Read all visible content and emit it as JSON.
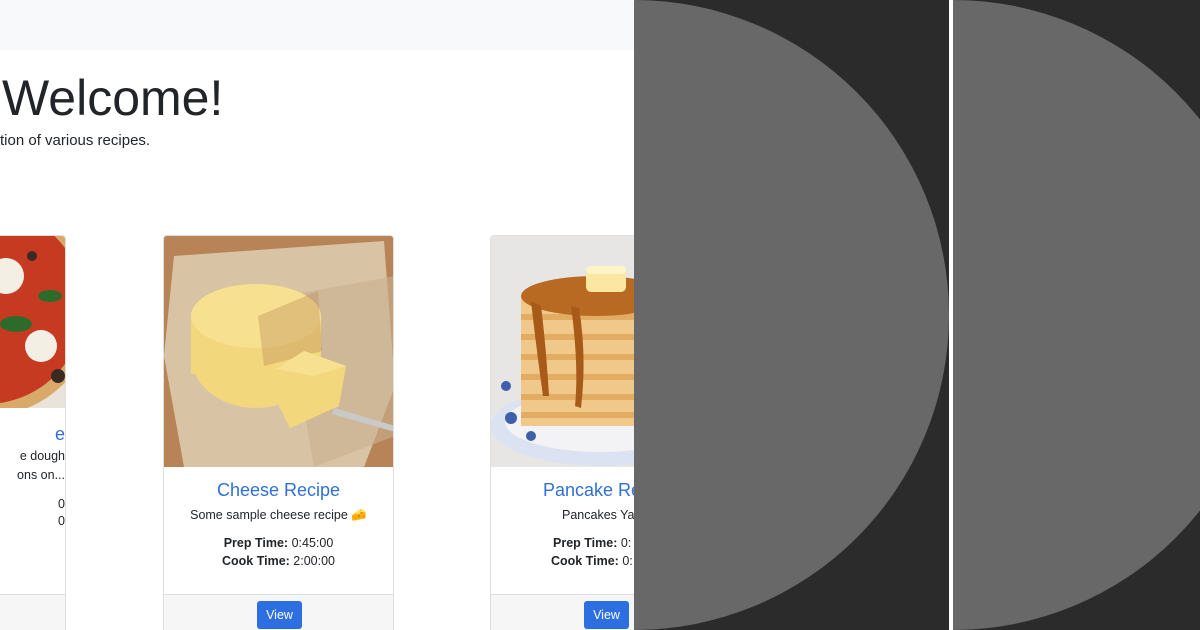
{
  "hero": {
    "title": "Welcome!",
    "subtitle": "tion of various recipes."
  },
  "cards": [
    {
      "title": "e",
      "text_line1": "e dough",
      "text_line2": "ons on...",
      "prep": "0",
      "cook": "0",
      "image": "pizza"
    },
    {
      "title": "Cheese Recipe",
      "text": "Some sample cheese recipe 🧀",
      "prep_label": "Prep Time:",
      "prep": "0:45:00",
      "cook_label": "Cook Time:",
      "cook": "2:00:00",
      "button": "View",
      "image": "cheese"
    },
    {
      "title": "Pancake Re",
      "text": "Pancakes Yay",
      "prep_label": "Prep Time:",
      "prep": "0:",
      "cook_label": "Cook Time:",
      "cook": "0:",
      "button": "View",
      "image": "pancakes"
    }
  ],
  "colors": {
    "link": "#2f6fd6",
    "button": "#2d6fe0",
    "panel_bg": "#2b2b2b",
    "circle": "#686868"
  }
}
